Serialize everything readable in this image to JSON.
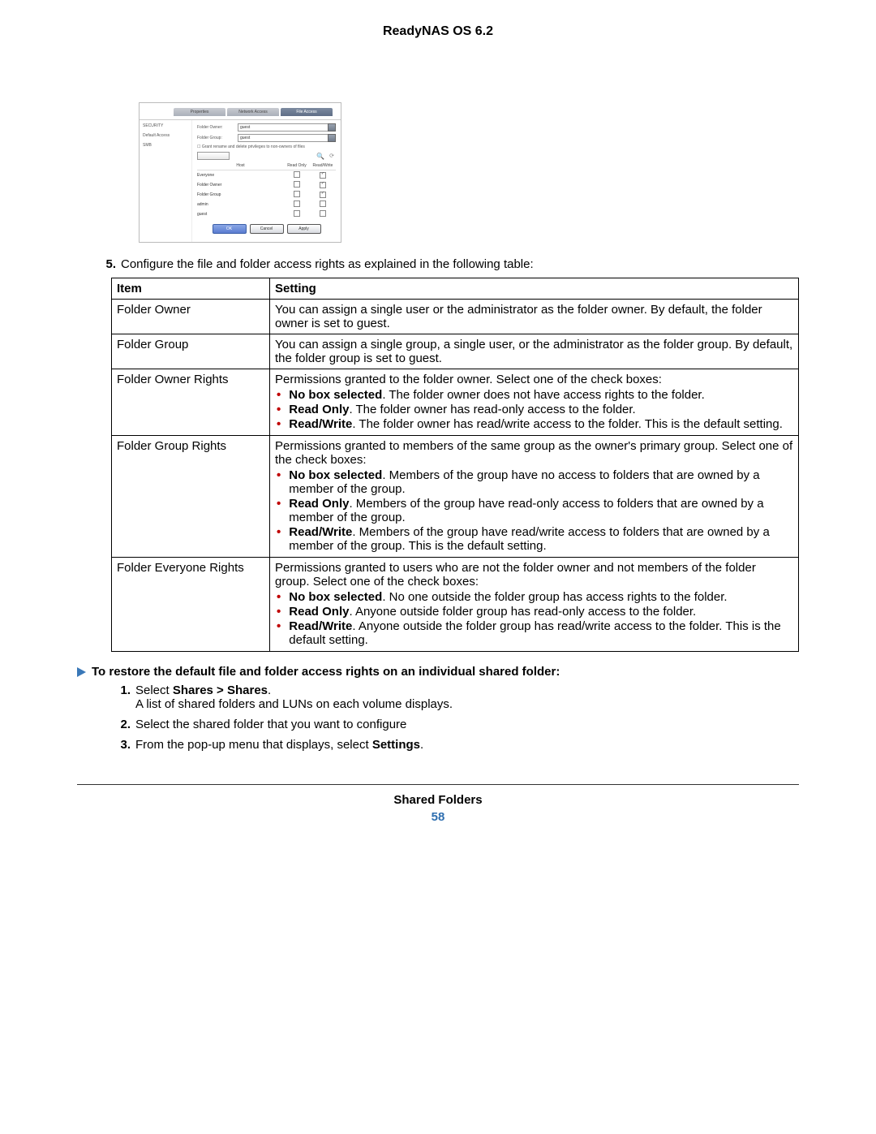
{
  "header": {
    "title": "ReadyNAS OS 6.2"
  },
  "screenshot": {
    "tabs": [
      "Properties",
      "Network Access",
      "File Access"
    ],
    "left_items": [
      "SECURITY",
      "Default Access",
      "SMB"
    ],
    "folder_owner_label": "Folder Owner:",
    "folder_owner_value": "guest",
    "folder_group_label": "Folder Group:",
    "folder_group_value": "guest",
    "checkbox_text": "Grant rename and delete privileges to non-owners of files",
    "list_headers": [
      "Host",
      "Read Only",
      "Read/Write"
    ],
    "rows": [
      {
        "name": "Everyone",
        "ro": false,
        "rw": true
      },
      {
        "name": "Folder Owner",
        "ro": false,
        "rw": true
      },
      {
        "name": "Folder Group",
        "ro": false,
        "rw": true
      },
      {
        "name": "admin",
        "ro": false,
        "rw": false
      },
      {
        "name": "guest",
        "ro": false,
        "rw": false
      }
    ],
    "buttons": {
      "ok": "OK",
      "cancel": "Cancel",
      "apply": "Apply"
    }
  },
  "step5": {
    "num": "5.",
    "text": "Configure the file and folder access rights as explained in the following table:"
  },
  "table": {
    "head_item": "Item",
    "head_setting": "Setting",
    "rows": [
      {
        "item": "Folder Owner",
        "plain": "You can assign a single user or the administrator as the folder owner. By default, the folder owner is set to guest."
      },
      {
        "item": "Folder Group",
        "plain": "You can assign a single group, a single user, or the administrator as the folder group. By default, the folder group is set to guest."
      },
      {
        "item": "Folder Owner Rights",
        "intro": "Permissions granted to the folder owner. Select one of the check boxes:",
        "bullets": [
          {
            "bold": "No box selected",
            "rest": ". The folder owner does not have access rights to the folder."
          },
          {
            "bold": "Read Only",
            "rest": ". The folder owner has read-only access to the folder."
          },
          {
            "bold": "Read/Write",
            "rest": ". The folder owner has read/write access to the folder. This is the default setting."
          }
        ]
      },
      {
        "item": "Folder Group Rights",
        "intro": "Permissions granted to members of the same group as the owner's primary group. Select one of the check boxes:",
        "bullets": [
          {
            "bold": "No box selected",
            "rest": ". Members of the group have no access to folders that are owned by a member of the group."
          },
          {
            "bold": "Read Only",
            "rest": ". Members of the group have read-only access to folders that are owned by a member of the group."
          },
          {
            "bold": "Read/Write",
            "rest": ". Members of the group have read/write access to folders that are owned by a member of the group. This is the default setting."
          }
        ]
      },
      {
        "item": "Folder Everyone Rights",
        "intro": "Permissions granted to users who are not the folder owner and not members of the folder group. Select one of the check boxes:",
        "bullets": [
          {
            "bold": "No box selected",
            "rest": ". No one outside the folder group has access rights to the folder."
          },
          {
            "bold": "Read Only",
            "rest": ". Anyone outside folder group has read-only access to the folder."
          },
          {
            "bold": "Read/Write",
            "rest": ". Anyone outside the folder group has read/write access to the folder. This is the default setting."
          }
        ]
      }
    ]
  },
  "procedure": {
    "title": "To restore the default file and folder access rights on an individual shared folder:",
    "steps": [
      {
        "num": "1.",
        "pre": "Select ",
        "bold": "Shares > Shares",
        "post": ".",
        "line2": "A list of shared folders and LUNs on each volume displays."
      },
      {
        "num": "2.",
        "text": "Select the shared folder that you want to configure"
      },
      {
        "num": "3.",
        "pre": "From the pop-up menu that displays, select ",
        "bold": "Settings",
        "post": "."
      }
    ]
  },
  "footer": {
    "section": "Shared Folders",
    "page": "58"
  }
}
